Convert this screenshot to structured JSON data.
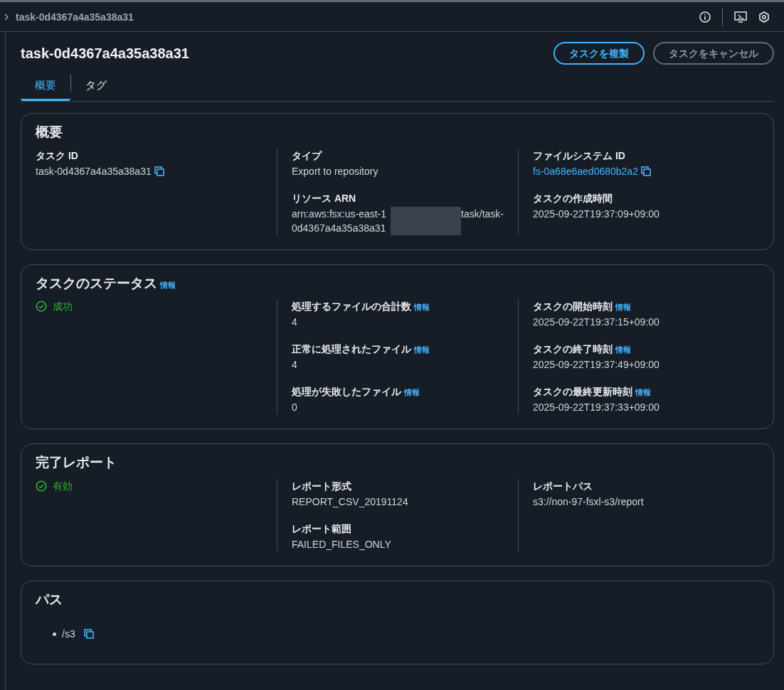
{
  "breadcrumb": "task-0d4367a4a35a38a31",
  "title": "task-0d4367a4a35a38a31",
  "buttons": [
    {
      "label": "タスクを複製",
      "kind": "primary"
    },
    {
      "label": "タスクをキャンセル",
      "kind": "normal"
    }
  ],
  "tabs": [
    {
      "label": "概要",
      "selected": true
    },
    {
      "label": "タグ",
      "selected": false
    }
  ],
  "sections": [
    {
      "kind": "columns",
      "title": "概要",
      "columns": [
        [
          {
            "kind": "field",
            "label": "タスク ID",
            "value": "task-0d4367a4a35a38a31",
            "copyable": true,
            "link": false
          }
        ],
        [
          {
            "kind": "field",
            "label": "タイプ",
            "value": "Export to repository",
            "copyable": false,
            "link": false
          },
          {
            "kind": "arn",
            "label": "リソース ARN",
            "prefix": "arn:aws:fsx:us-east-1",
            "suffix": "task/task-",
            "continuation": "0d4367a4a35a38a31"
          }
        ],
        [
          {
            "kind": "field",
            "label": "ファイルシステム ID",
            "value": "fs-0a68e6aed0680b2a2",
            "copyable": true,
            "link": true
          },
          {
            "kind": "field",
            "label": "タスクの作成時間",
            "value": "2025-09-22T19:37:09+09:00",
            "copyable": false,
            "link": false
          }
        ]
      ]
    },
    {
      "kind": "columns",
      "title": "タスクのステータス",
      "info": "情報",
      "columns": [
        [
          {
            "kind": "status",
            "text": "成功"
          }
        ],
        [
          {
            "kind": "field",
            "label": "処理するファイルの合計数",
            "info": "情報",
            "value": "4",
            "copyable": false,
            "link": false
          },
          {
            "kind": "field",
            "label": "正常に処理されたファイル",
            "info": "情報",
            "value": "4",
            "copyable": false,
            "link": false
          },
          {
            "kind": "field",
            "label": "処理が失敗したファイル",
            "info": "情報",
            "value": "0",
            "copyable": false,
            "link": false
          }
        ],
        [
          {
            "kind": "field",
            "label": "タスクの開始時刻",
            "info": "情報",
            "value": "2025-09-22T19:37:15+09:00",
            "copyable": false,
            "link": false
          },
          {
            "kind": "field",
            "label": "タスクの終了時刻",
            "info": "情報",
            "value": "2025-09-22T19:37:49+09:00",
            "copyable": false,
            "link": false
          },
          {
            "kind": "field",
            "label": "タスクの最終更新時刻",
            "info": "情報",
            "value": "2025-09-22T19:37:33+09:00",
            "copyable": false,
            "link": false
          }
        ]
      ]
    },
    {
      "kind": "columns",
      "title": "完了レポート",
      "columns": [
        [
          {
            "kind": "status",
            "text": "有効"
          }
        ],
        [
          {
            "kind": "field",
            "label": "レポート形式",
            "value": "REPORT_CSV_20191124",
            "copyable": false,
            "link": false
          },
          {
            "kind": "field",
            "label": "レポート範囲",
            "value": "FAILED_FILES_ONLY",
            "copyable": false,
            "link": false
          }
        ],
        [
          {
            "kind": "field",
            "label": "レポートパス",
            "value": "s3://non-97-fsxl-s3/report",
            "copyable": false,
            "link": false
          }
        ]
      ]
    },
    {
      "kind": "list",
      "title": "パス",
      "items": [
        {
          "text": "/s3",
          "copyable": true
        }
      ]
    }
  ]
}
